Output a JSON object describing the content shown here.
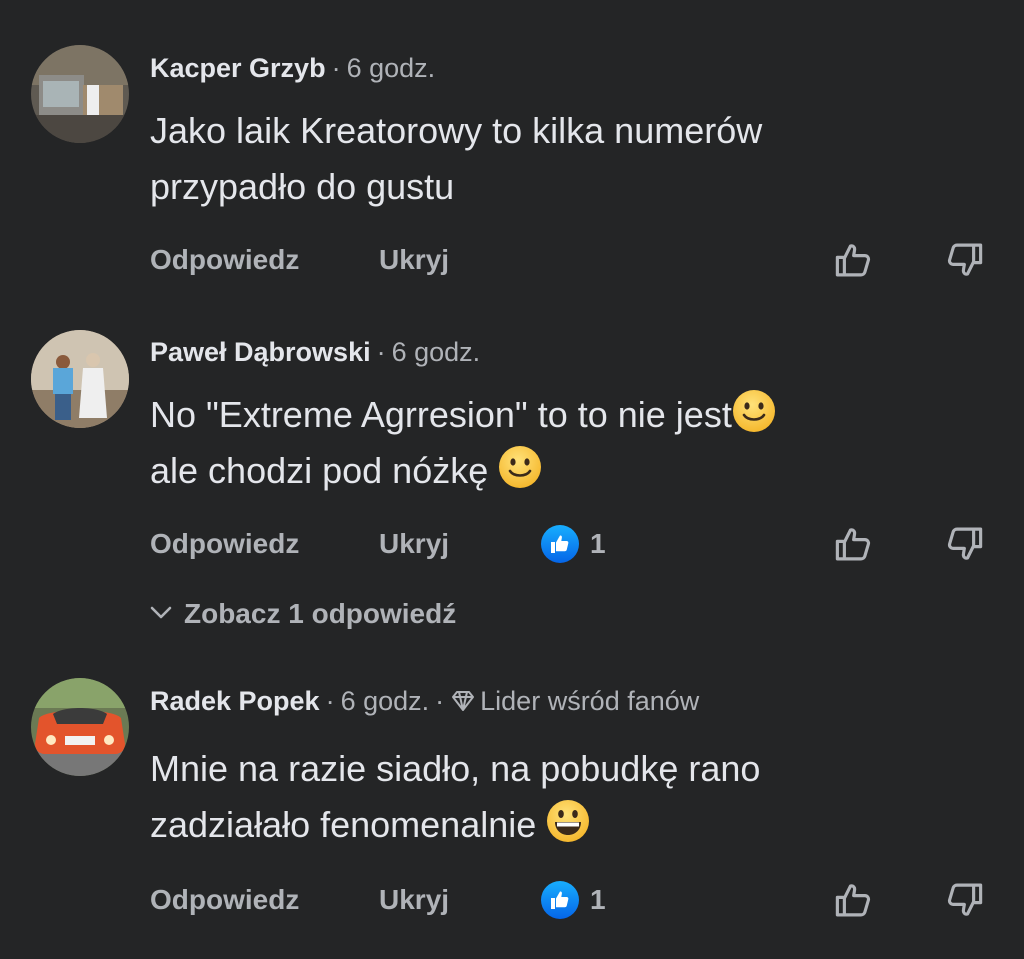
{
  "comments": [
    {
      "author": "Kacper Grzyb",
      "time": "6 godz.",
      "text_line1": "Jako laik Kreatorowy to kilka numerów",
      "text_line2": "przypadło do gustu",
      "reply_label": "Odpowiedz",
      "hide_label": "Ukryj"
    },
    {
      "author": "Paweł Dąbrowski",
      "time": "6 godz.",
      "text_line1": "No \"Extreme Agrresion\" to to nie jest",
      "text_line2": "ale chodzi pod nóżkę",
      "reply_label": "Odpowiedz",
      "hide_label": "Ukryj",
      "like_count": "1",
      "view_replies": "Zobacz 1 odpowiedź"
    },
    {
      "author": "Radek Popek",
      "time": "6 godz.",
      "badge": "Lider wśród fanów",
      "text_line1": "Mnie na razie siadło, na pobudkę rano",
      "text_line2": "zadziałało fenomenalnie",
      "reply_label": "Odpowiedz",
      "hide_label": "Ukryj",
      "like_count": "1"
    }
  ],
  "icons": {
    "upvote": "thumb-up-outline-icon",
    "downvote": "thumb-down-outline-icon",
    "like_reaction": "like-reaction-icon",
    "emoji_smile": "slightly-smiling-face",
    "emoji_grin": "grinning-face",
    "badge": "diamond-icon",
    "chevron": "chevron-down-icon"
  },
  "colors": {
    "background": "#242526",
    "primary_text": "#e4e6eb",
    "secondary_text": "#b0b3b8",
    "like_blue": "#1877f2"
  },
  "separator": "·"
}
